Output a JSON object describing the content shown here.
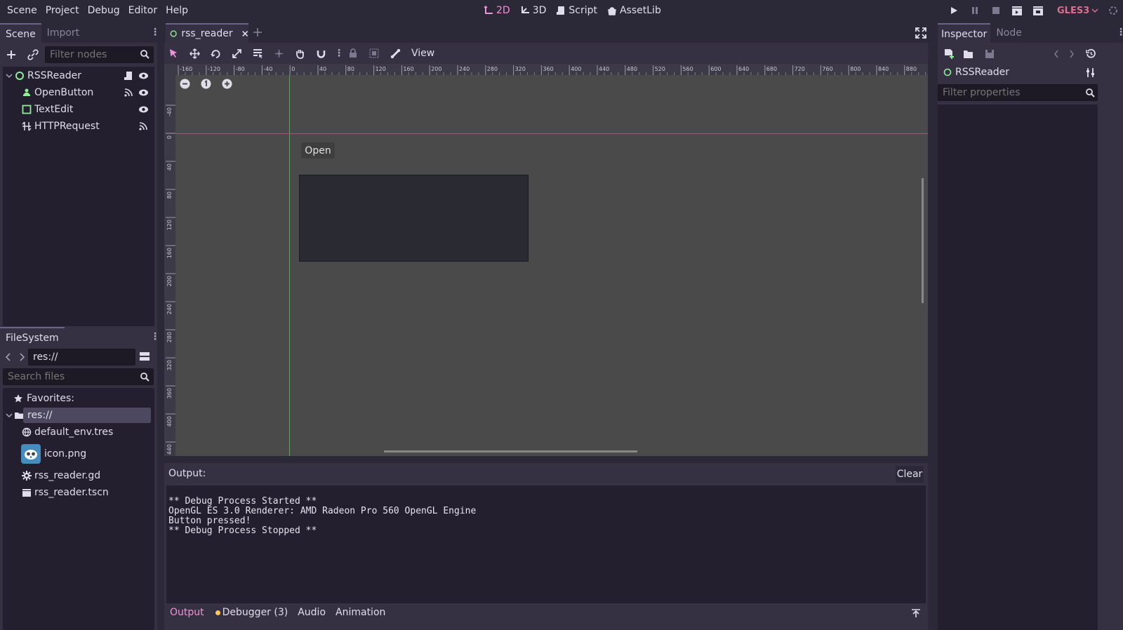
{
  "menu": [
    "Scene",
    "Project",
    "Debug",
    "Editor",
    "Help"
  ],
  "modes": {
    "m2d": "2D",
    "m3d": "3D",
    "script": "Script",
    "assetlib": "AssetLib"
  },
  "renderer": "GLES3",
  "scene_dock": {
    "tabs": [
      "Scene",
      "Import"
    ],
    "filter_placeholder": "Filter nodes",
    "nodes": [
      "RSSReader",
      "OpenButton",
      "TextEdit",
      "HTTPRequest"
    ]
  },
  "filesystem_dock": {
    "title": "FileSystem",
    "path": "res://",
    "search_placeholder": "Search files",
    "favorites": "Favorites:",
    "root": "res://",
    "files": [
      "default_env.tres",
      "icon.png",
      "rss_reader.gd",
      "rss_reader.tscn"
    ]
  },
  "editor": {
    "tab_name": "rss_reader",
    "view_label": "View",
    "open_button": "Open",
    "ruler_h": [
      "-160",
      "-120",
      "-80",
      "-40",
      "0",
      "40",
      "80",
      "120",
      "160",
      "200",
      "240",
      "280",
      "320",
      "360",
      "400",
      "440",
      "480",
      "520",
      "560",
      "600",
      "640",
      "680",
      "720",
      "760",
      "800",
      "840",
      "880"
    ],
    "ruler_v": [
      "-40",
      "0",
      "40",
      "80",
      "120",
      "160",
      "200",
      "240",
      "280",
      "320",
      "360",
      "400",
      "440"
    ]
  },
  "output": {
    "label": "Output:",
    "clear": "Clear",
    "lines": [
      "** Debug Process Started **",
      "OpenGL ES 3.0 Renderer: AMD Radeon Pro 560 OpenGL Engine",
      "Button pressed!",
      "** Debug Process Stopped **"
    ],
    "bottom_tabs": [
      "Output",
      "Debugger (3)",
      "Audio",
      "Animation"
    ]
  },
  "inspector": {
    "tabs": [
      "Inspector",
      "Node"
    ],
    "object": "RSSReader",
    "filter_placeholder": "Filter properties"
  },
  "colors": {
    "accent": "#f092d8",
    "gles": "#e06c8e",
    "node_green": "#8eef97"
  }
}
